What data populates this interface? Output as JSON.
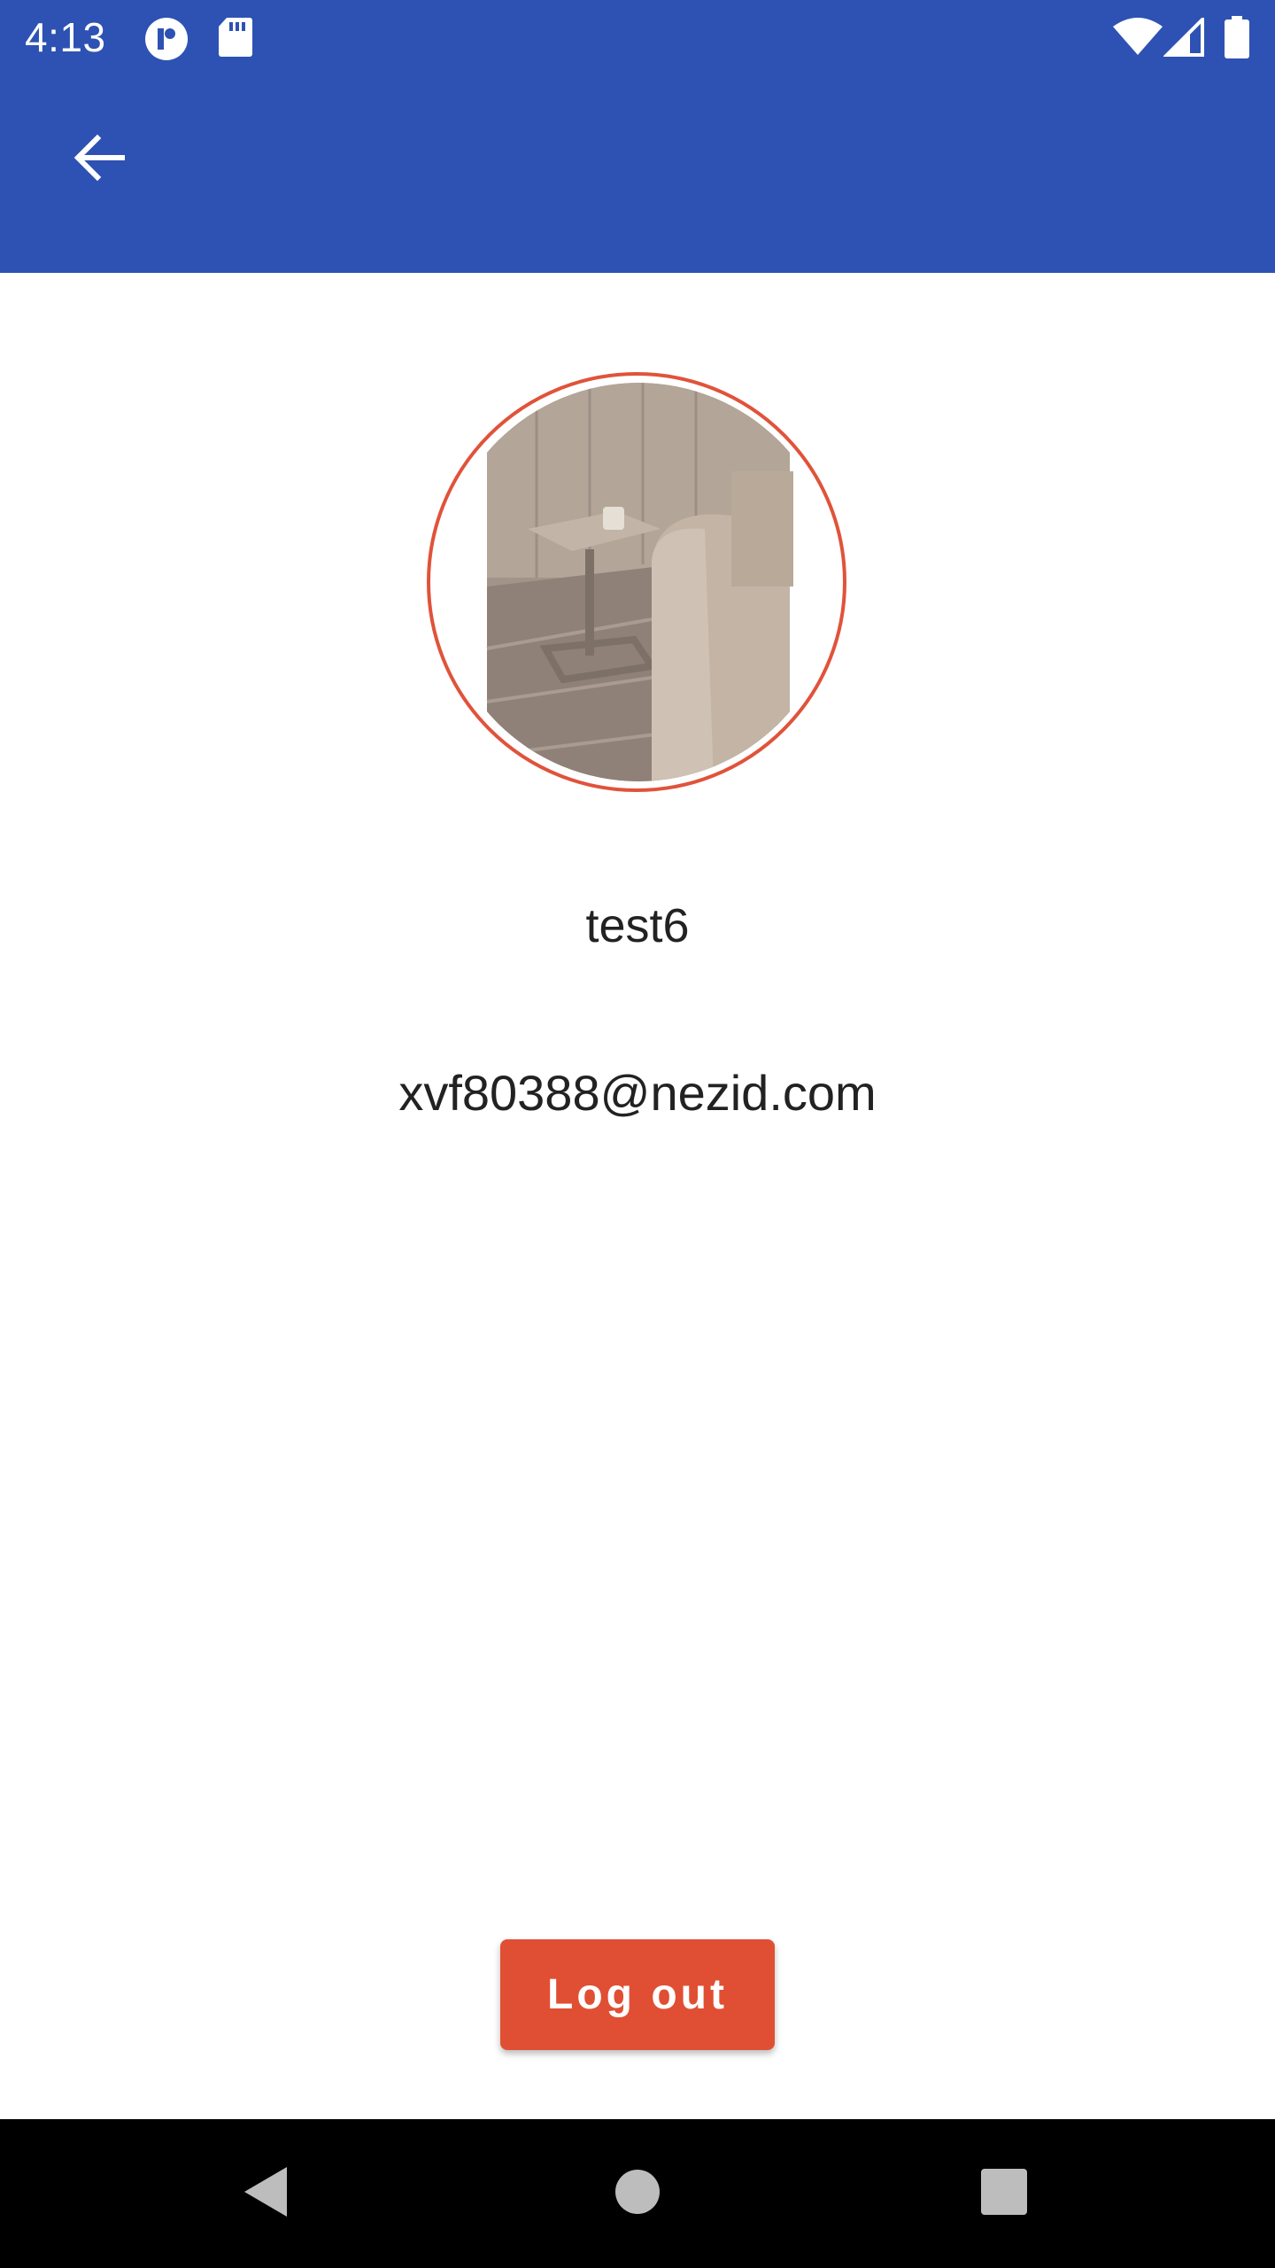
{
  "status_bar": {
    "time": "4:13",
    "icons_left": [
      "notification-app-icon",
      "sd-card-icon"
    ],
    "icons_right": [
      "wifi-icon",
      "cell-signal-icon",
      "battery-icon"
    ]
  },
  "app_bar": {
    "back_icon": "arrow-back-icon"
  },
  "profile": {
    "name": "test6",
    "email": "xvf80388@nezid.com"
  },
  "actions": {
    "logout_label": "Log out"
  },
  "nav_bar": {
    "icons": [
      "nav-back-icon",
      "nav-home-icon",
      "nav-recents-icon"
    ]
  },
  "colors": {
    "primary": "#2d52b3",
    "accent": "#e04f33",
    "text": "#222222",
    "nav_background": "#000000"
  }
}
